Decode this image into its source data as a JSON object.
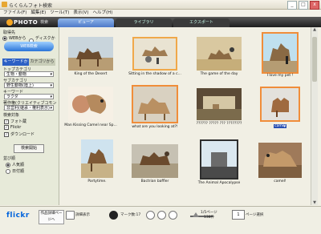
{
  "window": {
    "title": "らくらんフォト検索",
    "min": "_",
    "max": "□",
    "close": "x"
  },
  "menu": [
    "ファイル(F)",
    "編集(E)",
    "ツール(T)",
    "表示(V)",
    "ヘルプ(H)"
  ],
  "header": {
    "logo_word": "PHOTO",
    "logo_sub": "検索",
    "tabs": [
      "ビューア",
      "ライブラリ",
      "エクスポート"
    ]
  },
  "sidebar": {
    "source_label": "取得先",
    "source_web": "WEBから",
    "source_disk": "ディスクから",
    "web_button": "WEB検索",
    "tab_keyword": "キーワードから",
    "tab_category": "カテゴリから",
    "top_category_label": "トップカテゴリ",
    "top_category_value": "生物・動物",
    "sub_category_label": "サブカテゴリ",
    "sub_category_value": "野生動物(陸上)",
    "keyword_label": "キーワード",
    "keyword_value": "ラクダ",
    "license_label": "著作権(クリエイティブコモンズ)",
    "license_value": "非営利(継承・権利表示)",
    "search_target_label": "検索対象",
    "target_photo": "フォト蔵",
    "target_flickr": "Flickr",
    "target_daily": "ダウンロード",
    "search_button": "検索開始",
    "sort_label": "並び順",
    "sort_popular": "人気順",
    "sort_date": "日付順"
  },
  "photos": [
    {
      "caption": "King of the Desert"
    },
    {
      "caption": "Sitting in the shadow of a c..."
    },
    {
      "caption": "The game of the day"
    },
    {
      "caption": "I love my pet !"
    },
    {
      "caption": "Man Kissing Camel near Sp..."
    },
    {
      "caption": "what are you looking at?!"
    },
    {
      "caption": "?????? ????? ??? ????????"
    },
    {
      "caption": "camel"
    },
    {
      "caption": "Partytime."
    },
    {
      "caption": "Bactrian baffler"
    },
    {
      "caption": "The Animal Apocalypse"
    },
    {
      "caption": "camel!"
    }
  ],
  "bottom": {
    "brand": "flickr",
    "btn_work": "作品詳細ページへ",
    "label_detail": "詳細表示",
    "mark_count": "マーク数:17",
    "page_info_top": "1/5ページ",
    "page_info_bottom": "138件",
    "page_value": "1",
    "page_select": "ページ選択"
  }
}
